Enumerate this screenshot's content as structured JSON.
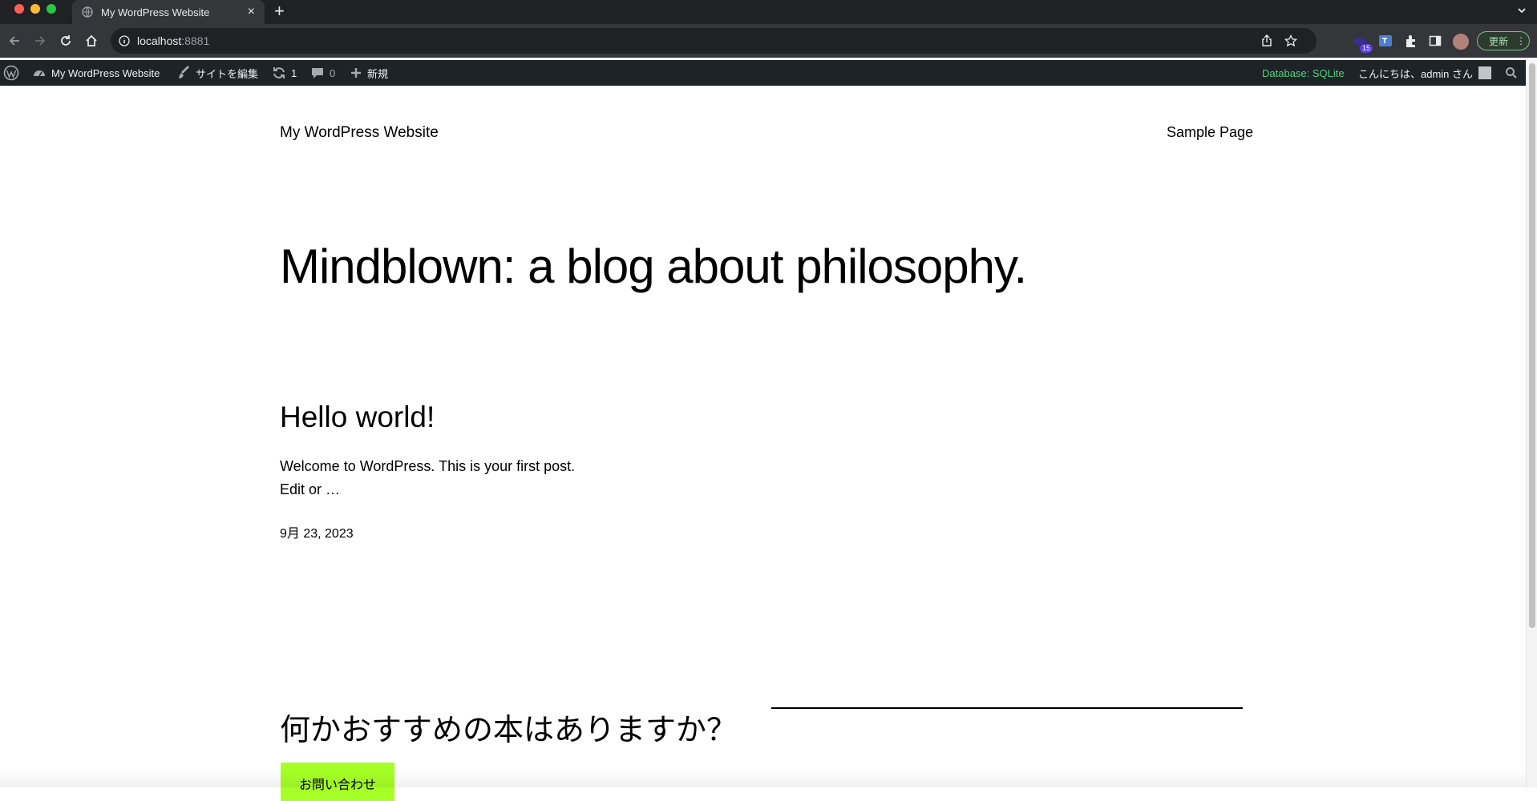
{
  "browser": {
    "tab_title": "My WordPress Website",
    "url_host": "localhost",
    "url_port": ":8881",
    "extension_badge": "15",
    "update_label": "更新"
  },
  "admin_bar": {
    "site_name": "My WordPress Website",
    "edit_site": "サイトを編集",
    "updates_count": "1",
    "comments_count": "0",
    "new_label": "新規",
    "database": "Database: SQLite",
    "greeting": "こんにちは、admin さん"
  },
  "site": {
    "title": "My WordPress Website",
    "nav": [
      "Sample Page"
    ],
    "tagline": "Mindblown: a blog about philosophy."
  },
  "post": {
    "title": "Hello world!",
    "excerpt_line1": "Welcome to WordPress. This is your first post.",
    "excerpt_line2": "Edit or …",
    "date": "9月 23, 2023"
  },
  "cta": {
    "heading": "何かおすすめの本はありますか？",
    "button_label": "お問い合わせ",
    "button_color": "#a6ff26"
  },
  "icons": [
    "globe-icon",
    "close-icon",
    "plus-icon",
    "chevron-down-icon",
    "back-icon",
    "forward-icon",
    "reload-icon",
    "home-icon",
    "info-icon",
    "share-icon",
    "star-icon",
    "translate-icon",
    "extensions-icon",
    "sidepanel-icon",
    "wordpress-logo-icon",
    "dashboard-icon",
    "brush-icon",
    "updates-icon",
    "comments-icon",
    "search-icon"
  ]
}
